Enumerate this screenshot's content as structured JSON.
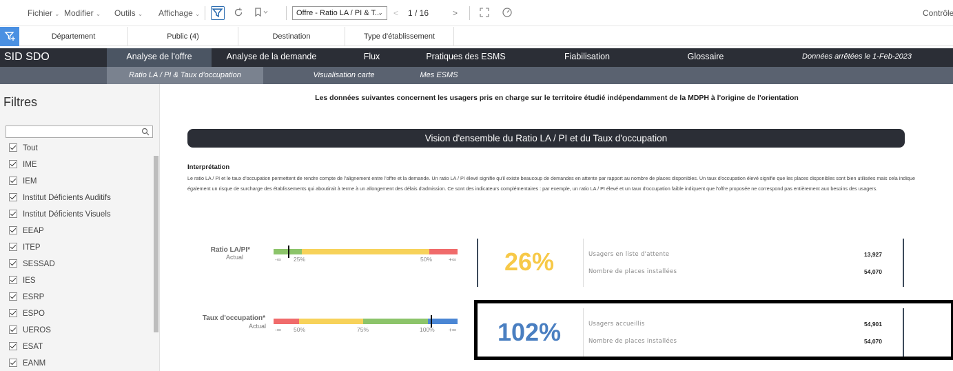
{
  "toolbar": {
    "menus": [
      "Fichier",
      "Modifier",
      "Outils",
      "Affichage"
    ],
    "story_title": "Offre - Ratio LA / PI & T...",
    "page_indicator": "1 / 16",
    "controls_label": "Contrôles"
  },
  "filter_tabs": [
    "Département",
    "Public (4)",
    "Destination",
    "Type d'établissement"
  ],
  "navbar": {
    "brand": "SID SDO",
    "items": [
      "Analyse de l'offre",
      "Analyse de la demande",
      "Flux",
      "Pratiques des ESMS",
      "Fiabilisation",
      "Glossaire"
    ],
    "active_index": 0,
    "date_label": "Données arrêtées le   1-Feb-2023"
  },
  "subnav": {
    "items": [
      "Ratio LA / PI & Taux d'occupation",
      "Visualisation carte",
      "Mes ESMS"
    ],
    "active_index": 0
  },
  "sidebar": {
    "title": "Filtres",
    "search_placeholder": "",
    "items": [
      "Tout",
      "IME",
      "IEM",
      "Institut Déficients Auditifs",
      "Institut Déficients Visuels",
      "EEAP",
      "ITEP",
      "SESSAD",
      "IES",
      "ESRP",
      "ESPO",
      "UEROS",
      "ESAT",
      "EANM"
    ]
  },
  "main": {
    "intro": "Les données suivantes concernent les usagers pris en charge sur le territoire étudié indépendamment de la MDPH à l'origine de l'orientation",
    "banner": "Vision d'ensemble du Ratio LA / PI et du Taux d'occupation",
    "interp_title": "Interprétation",
    "interp_text": "Le ratio LA / PI et le taux d'occupation permettent de rendre compte de l'alignement entre l'offre et la demande. Un ratio LA / PI élevé signifie qu'il existe beaucoup de demandes en attente par rapport au nombre de places disponibles. Un taux d'occupation élevé signifie que les places disponibles sont bien utilisées mais cela indique également un risque de surcharge des établissements qui aboutirait à terme à un allongement des délais d'admission. Ce sont des indicateurs complémentaires : par exemple, un ratio LA / PI élevé et un taux d'occupation faible indiquent que l'offre proposée ne correspond pas entièrement aux besoins des usagers."
  },
  "kpis": [
    {
      "label": "Ratio LA/PI*",
      "sub": "Actual",
      "ticks": [
        "-∞",
        "25%",
        "50%",
        "+∞"
      ],
      "marker_fraction": 0.08,
      "percent": "26%",
      "percent_color": "#f7c948",
      "stats": [
        {
          "label": "Usagers en liste d'attente",
          "value": "13,927"
        },
        {
          "label": "Nombre de places installées",
          "value": "54,070"
        }
      ]
    },
    {
      "label": "Taux d'occupation*",
      "sub": "Actual",
      "ticks": [
        "-∞",
        "50%",
        "75%",
        "100%",
        "+∞"
      ],
      "marker_fraction": 0.855,
      "percent": "102%",
      "percent_color": "#4a7fc1",
      "stats": [
        {
          "label": "Usagers accueillis",
          "value": "54,901"
        },
        {
          "label": "Nombre de places installées",
          "value": "54,070"
        }
      ]
    }
  ],
  "colors": {
    "green": "#8cc46a",
    "yellow": "#f7d25a",
    "red": "#f06b6b",
    "blue": "#4a86d4",
    "nav_dark": "#2b2e36"
  }
}
